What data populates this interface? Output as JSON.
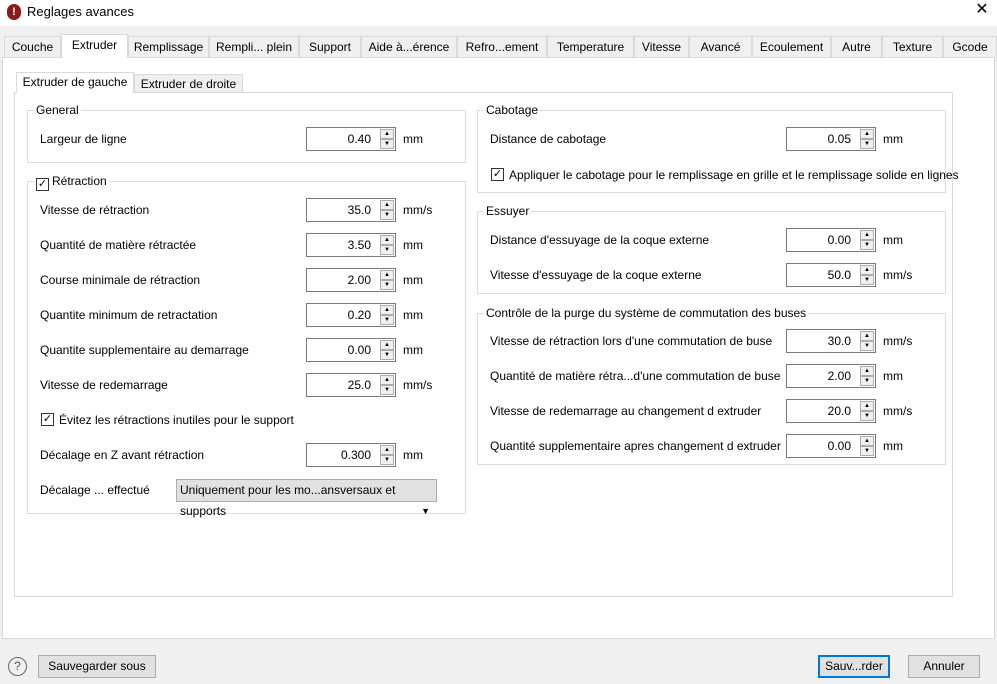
{
  "window": {
    "title": "Reglages avances",
    "close": "✕"
  },
  "tabs": [
    "Couche",
    "Extruder",
    "Remplissage",
    "Rempli... plein",
    "Support",
    "Aide à...érence",
    "Refro...ement",
    "Temperature",
    "Vitesse",
    "Avancé",
    "Ecoulement",
    "Autre",
    "Texture",
    "Gcode"
  ],
  "active_tab": "Extruder",
  "subtabs": [
    "Extruder de gauche",
    "Extruder de droite"
  ],
  "general": {
    "title": "General",
    "rows": [
      {
        "label": "Largeur de ligne",
        "value": "0.40",
        "unit": "mm"
      }
    ]
  },
  "retraction": {
    "title": "Rétraction",
    "checked": true,
    "rows": [
      {
        "label": "Vitesse de rétraction",
        "value": "35.0",
        "unit": "mm/s"
      },
      {
        "label": "Quantité de matière rétractée",
        "value": "3.50",
        "unit": "mm"
      },
      {
        "label": "Course minimale de rétraction",
        "value": "2.00",
        "unit": "mm"
      },
      {
        "label": "Quantite minimum de retractation",
        "value": "0.20",
        "unit": "mm"
      },
      {
        "label": "Quantite supplementaire au demarrage",
        "value": "0.00",
        "unit": "mm"
      },
      {
        "label": "Vitesse de redemarrage",
        "value": "25.0",
        "unit": "mm/s"
      }
    ],
    "avoid_label": "Évitez les rétractions inutiles pour le support",
    "avoid_checked": true,
    "zhop": {
      "label": "Décalage en Z avant rétraction",
      "value": "0.300",
      "unit": "mm"
    },
    "zhop_mode": {
      "label": "Décalage ... effectué",
      "value": "Uniquement pour les mo...ansversaux et supports"
    }
  },
  "cabotage": {
    "title": "Cabotage",
    "rows": [
      {
        "label": "Distance de cabotage",
        "value": "0.05",
        "unit": "mm"
      }
    ],
    "apply_label": "Appliquer le cabotage pour le remplissage en grille et le remplissage solide en lignes",
    "apply_checked": true
  },
  "essuyer": {
    "title": "Essuyer",
    "rows": [
      {
        "label": "Distance d'essuyage de la coque externe",
        "value": "0.00",
        "unit": "mm"
      },
      {
        "label": "Vitesse d'essuyage de la coque externe",
        "value": "50.0",
        "unit": "mm/s"
      }
    ]
  },
  "purge": {
    "title": "Contrôle de la purge du système de commutation des buses",
    "rows": [
      {
        "label": "Vitesse de rétraction lors d'une commutation de buse",
        "value": "30.0",
        "unit": "mm/s"
      },
      {
        "label": "Quantité de matière rétra...d'une commutation de buse",
        "value": "2.00",
        "unit": "mm"
      },
      {
        "label": "Vitesse de redemarrage au changement d extruder",
        "value": "20.0",
        "unit": "mm/s"
      },
      {
        "label": "Quantité supplementaire apres changement d extruder",
        "value": "0.00",
        "unit": "mm"
      }
    ]
  },
  "footer": {
    "help": "?",
    "save_as": "Sauvegarder sous",
    "save": "Sauv...rder",
    "cancel": "Annuler"
  },
  "colors": {
    "accent": "#0078d7",
    "app_icon": "#8b1a1a"
  }
}
